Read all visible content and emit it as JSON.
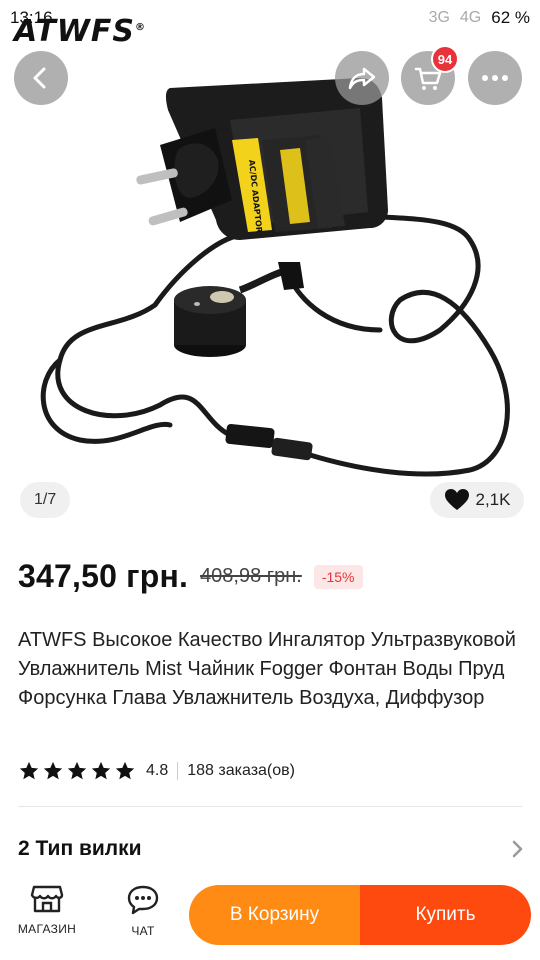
{
  "status_bar": {
    "time": "13:16",
    "network_3g": "3G",
    "network_4g": "4G",
    "battery": "62 %"
  },
  "gallery": {
    "brand_watermark": "ATWFS",
    "brand_mark": "®",
    "adapter_label": "AC/DC ADAPTOR",
    "position": "1/7",
    "likes": "2,1K",
    "cart_count": "94"
  },
  "product": {
    "price": "347,50 грн.",
    "old_price": "408,98 грн.",
    "discount": "-15%",
    "title": "ATWFS Высокое Качество Ингалятор Ультразвуковой Увлажнитель Mist Чайник Fogger Фонтан Воды Пруд Форсунка Глава Увлажнитель Воздуха, Диффузор",
    "rating": "4.8",
    "orders": "188 заказа(ов)",
    "rating_stars": 5
  },
  "option": {
    "label": "2 Тип вилки"
  },
  "bottom_bar": {
    "store_label": "МАГАЗИН",
    "chat_label": "ЧАТ",
    "add_to_cart": "В Корзину",
    "buy": "Купить"
  },
  "icons": {
    "back": "arrow-left-icon",
    "share": "share-icon",
    "cart": "cart-icon",
    "more": "more-icon",
    "heart": "heart-icon",
    "star": "star-icon",
    "chevron": "chevron-right-icon",
    "store": "store-icon",
    "chat": "chat-icon"
  },
  "colors": {
    "accent_orange": "#ff8a14",
    "accent_red_orange": "#ff4a0f",
    "discount_red": "#e8333a",
    "badge_red": "#e8333a"
  }
}
